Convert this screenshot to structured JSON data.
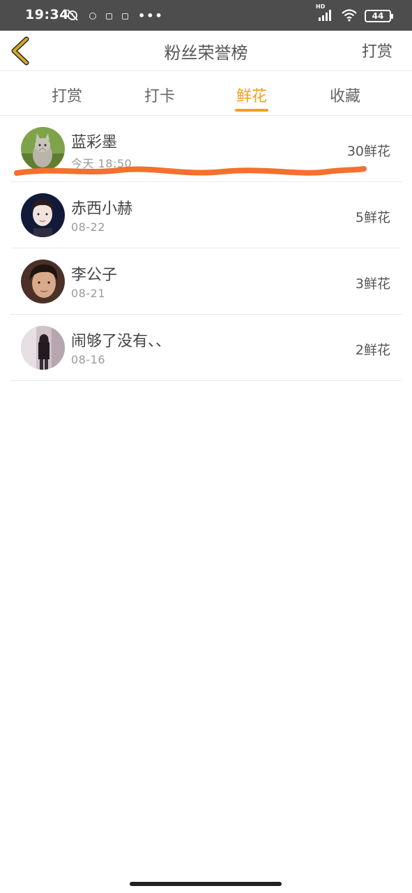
{
  "status_bar": {
    "time": "19:34",
    "battery": "44",
    "network_label": "HD"
  },
  "header": {
    "title": "粉丝荣誉榜",
    "action_label": "打赏"
  },
  "tabs": [
    {
      "label": "打赏",
      "active": false
    },
    {
      "label": "打卡",
      "active": false
    },
    {
      "label": "鲜花",
      "active": true
    },
    {
      "label": "收藏",
      "active": false
    }
  ],
  "fans": [
    {
      "name": "蓝彩墨",
      "date": "今天 18:50",
      "amount": "30鲜花",
      "avatar": "cat-photo-avatar"
    },
    {
      "name": "赤西小赫",
      "date": "08-22",
      "amount": "5鲜花",
      "avatar": "young-man-dark-avatar"
    },
    {
      "name": "李公子",
      "date": "08-21",
      "amount": "3鲜花",
      "avatar": "man-face-avatar"
    },
    {
      "name": "闹够了没有、、",
      "date": "08-16",
      "amount": "2鲜花",
      "avatar": "figure-photo-avatar"
    }
  ],
  "colors": {
    "accent": "#f3a01f",
    "back_arrow": "#d4a82a",
    "annotation_stroke": "#f4702d",
    "status_bar_bg": "#4d4d4d"
  }
}
